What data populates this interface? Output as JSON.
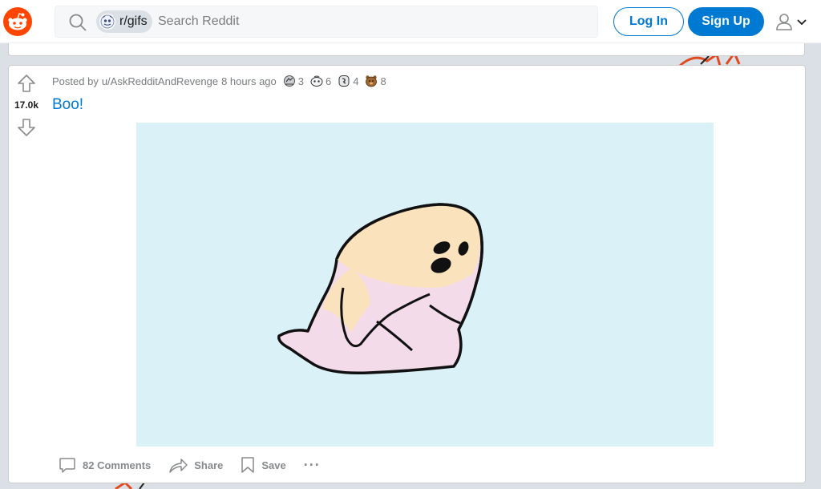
{
  "header": {
    "subreddit_chip": "r/gifs",
    "search_placeholder": "Search Reddit",
    "login_label": "Log In",
    "signup_label": "Sign Up"
  },
  "post": {
    "vote_count": "17.0k",
    "meta_prefix": "Posted by",
    "author": "u/AskRedditAndRevenge",
    "time": "8 hours ago",
    "awards": [
      {
        "icon": "silver-award-icon",
        "count": "3"
      },
      {
        "icon": "helpful-award-icon",
        "count": "6"
      },
      {
        "icon": "wholesome-award-icon",
        "count": "4"
      },
      {
        "icon": "bear-award-icon",
        "count": "8"
      }
    ],
    "title": "Boo!",
    "actions": {
      "comments": "82 Comments",
      "share": "Share",
      "save": "Save",
      "more": "···"
    }
  },
  "colors": {
    "brand": "#ff4500",
    "accent": "#0079d3",
    "media_bg": "#daf1f7"
  }
}
